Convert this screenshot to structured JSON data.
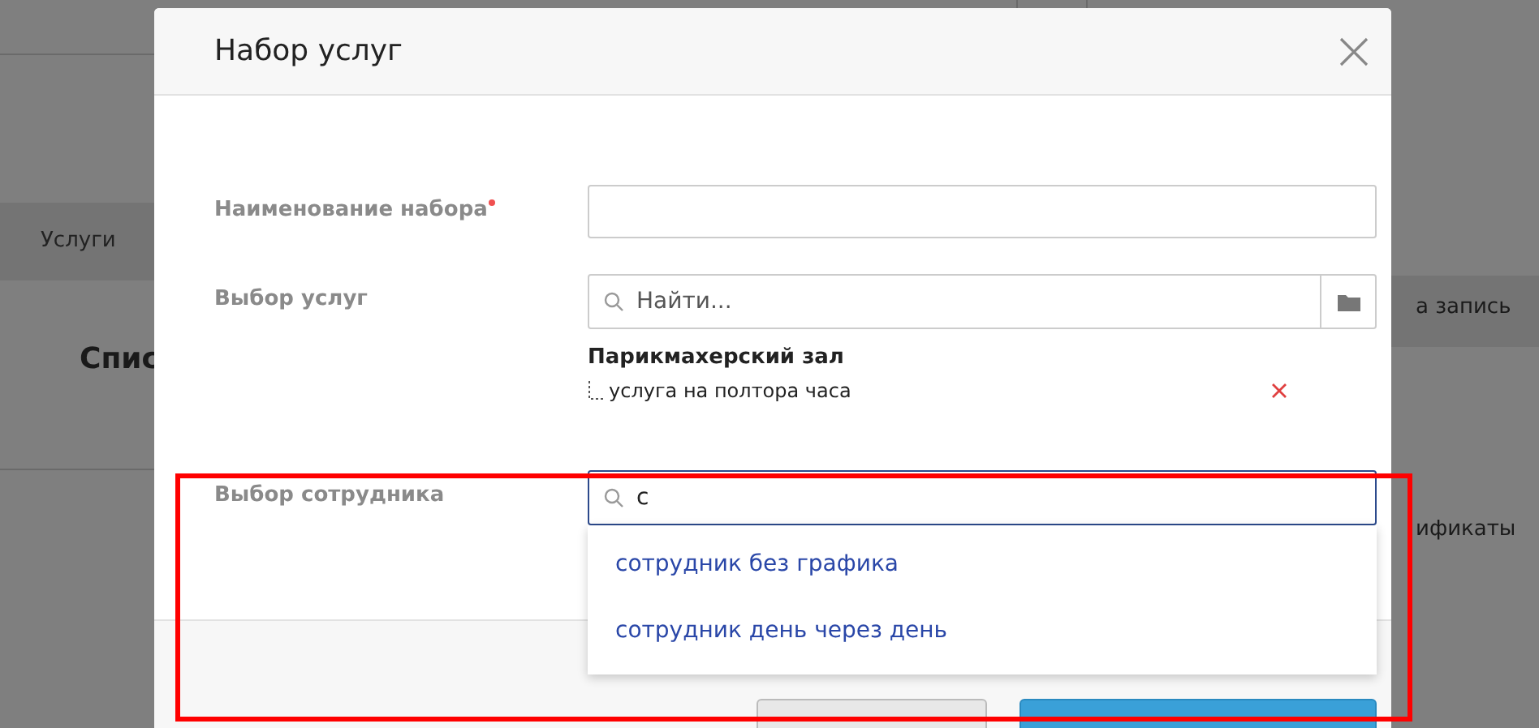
{
  "background": {
    "tab": "Услуги",
    "title": "Спис",
    "side_texts": [
      "а запись",
      "ификаты"
    ]
  },
  "dialog": {
    "title": "Набор услуг",
    "fields": [
      {
        "kind": "text",
        "label": "Наименование набора",
        "required": true
      },
      {
        "kind": "picker",
        "label": "Выбор услуг",
        "placeholder": "Найти...",
        "group": "Парикмахерский зал",
        "items": [
          "услуга на полтора часа"
        ]
      },
      {
        "kind": "search",
        "label": "Выбор сотрудника",
        "value": "с",
        "focused": true,
        "suggestions": [
          "сотрудник без графика",
          "сотрудник день через день"
        ]
      }
    ]
  }
}
